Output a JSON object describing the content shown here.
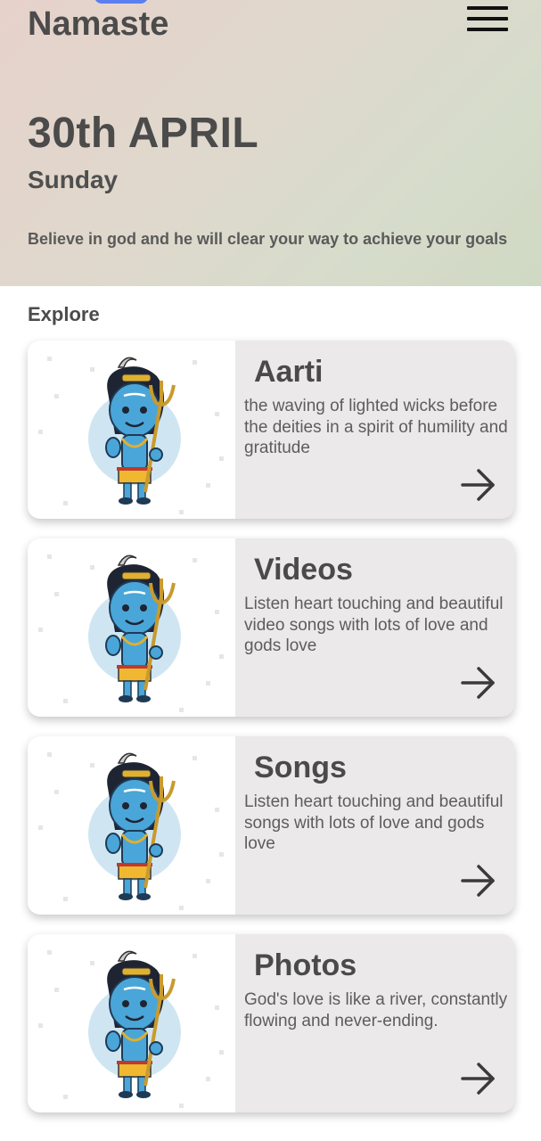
{
  "header": {
    "app_title": "Namaste",
    "date": "30th APRIL",
    "day": "Sunday",
    "quote": "Believe in god and he will clear your way to achieve your goals",
    "menu_icon": "hamburger-menu-icon"
  },
  "explore": {
    "heading": "Explore",
    "cards": [
      {
        "title": "Aarti",
        "description": "the waving of lighted wicks before the deities in a spirit of humility and gratitude",
        "image": "shiva-illustration",
        "arrow_icon": "arrow-right-icon"
      },
      {
        "title": "Videos",
        "description": "Listen heart touching and beautiful video songs with lots of love and gods love",
        "image": "shiva-illustration",
        "arrow_icon": "arrow-right-icon"
      },
      {
        "title": "Songs",
        "description": "Listen heart touching and beautiful songs with lots of love and gods love",
        "image": "shiva-illustration",
        "arrow_icon": "arrow-right-icon"
      },
      {
        "title": "Photos",
        "description": "God's love is like a river, constantly flowing and never-ending.",
        "image": "shiva-illustration",
        "arrow_icon": "arrow-right-icon"
      }
    ]
  },
  "colors": {
    "header_gradient_start": "#e6d2cb",
    "header_gradient_end": "#cfd9c3",
    "card_background": "#ebe9ea",
    "text_primary": "#4a4a4a",
    "accent_blue": "#5b7ff0"
  }
}
